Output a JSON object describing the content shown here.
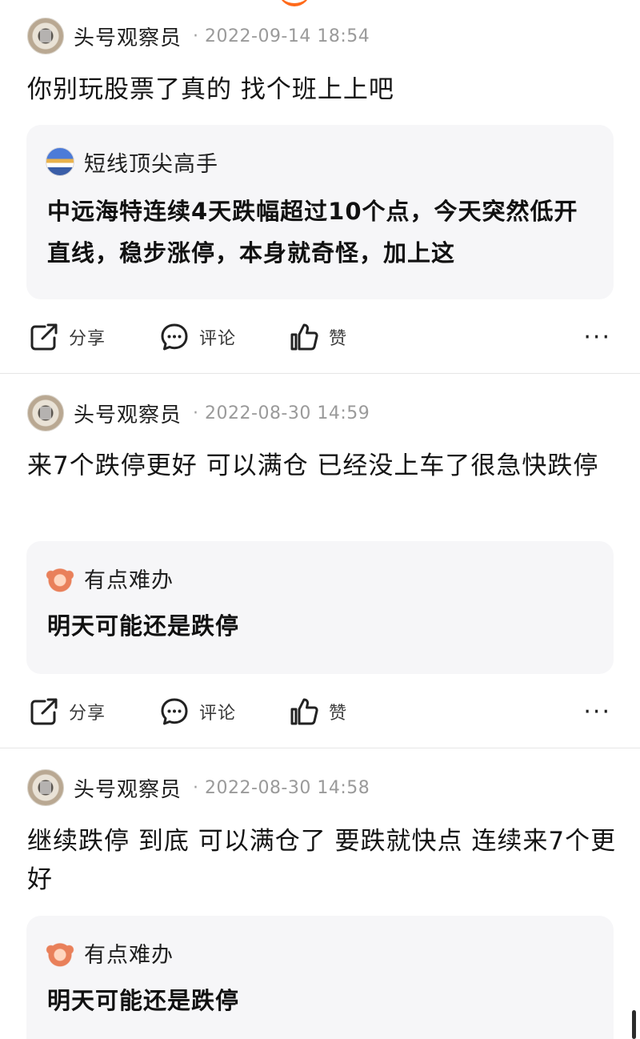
{
  "colors": {
    "accent": "#ff6a1a",
    "quote_bg": "#f6f6f8",
    "muted": "#9a9a9a"
  },
  "icons": {
    "share": "share-icon",
    "comment": "comment-icon",
    "like": "thumbs-up-icon",
    "more": "more-icon"
  },
  "posts": [
    {
      "author": "头号观察员",
      "time": "2022-09-14 18:54",
      "text": "你别玩股票了真的 找个班上上吧",
      "quote": {
        "author": "短线顶尖高手",
        "text": "中远海特连续4天跌幅超过10个点，今天突然低开直线，稳步涨停，本身就奇怪，加上这"
      },
      "actions": {
        "share": "分享",
        "comment": "评论",
        "like": "赞",
        "more": "···"
      }
    },
    {
      "author": "头号观察员",
      "time": "2022-08-30 14:59",
      "text": "来7个跌停更好 可以满仓 已经没上车了很急快跌停",
      "quote": {
        "author": "有点难办",
        "text": "明天可能还是跌停"
      },
      "actions": {
        "share": "分享",
        "comment": "评论",
        "like": "赞",
        "more": "···"
      }
    },
    {
      "author": "头号观察员",
      "time": "2022-08-30 14:58",
      "text": "继续跌停 到底 可以满仓了 要跌就快点 连续来7个更好",
      "quote": {
        "author": "有点难办",
        "text": "明天可能还是跌停"
      }
    }
  ]
}
